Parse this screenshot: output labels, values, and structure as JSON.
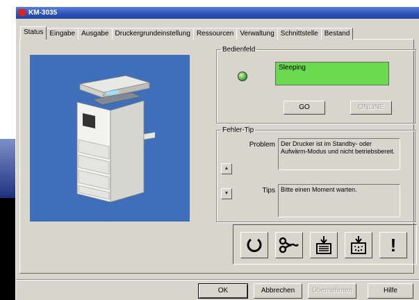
{
  "window": {
    "title": "KM-3035"
  },
  "tabs": [
    {
      "label": "Status",
      "active": true
    },
    {
      "label": "Eingabe"
    },
    {
      "label": "Ausgabe"
    },
    {
      "label": "Druckergrundeinstellung"
    },
    {
      "label": "Ressourcen"
    },
    {
      "label": "Verwaltung"
    },
    {
      "label": "Schnittstelle"
    },
    {
      "label": "Bestand"
    }
  ],
  "bedienfeld": {
    "legend": "Bedienfeld",
    "status_text": "Sleeping",
    "go_label": "GO",
    "online_label": "ONLINE"
  },
  "fehler_tip": {
    "legend": "Fehler-Tip",
    "problem_label": "Problem",
    "problem_text": "Der Drucker ist im Standby- oder Aufwärm-Modus und nicht betriebsbereit.",
    "tips_label": "Tips",
    "tips_text": "Bitte einen Moment warten."
  },
  "toolbar": {
    "icons": [
      "refresh-icon",
      "scissors-icon",
      "paper-tray-icon",
      "toner-icon",
      "alert-icon"
    ]
  },
  "footer": {
    "ok_label": "OK",
    "cancel_label": "Abbrechen",
    "apply_label": "Übernehmen",
    "help_label": "Hilfe"
  },
  "colors": {
    "title_bar": "#2b50b8",
    "status_green": "#6bd94e",
    "printer_bg": "#3e6fb8"
  }
}
